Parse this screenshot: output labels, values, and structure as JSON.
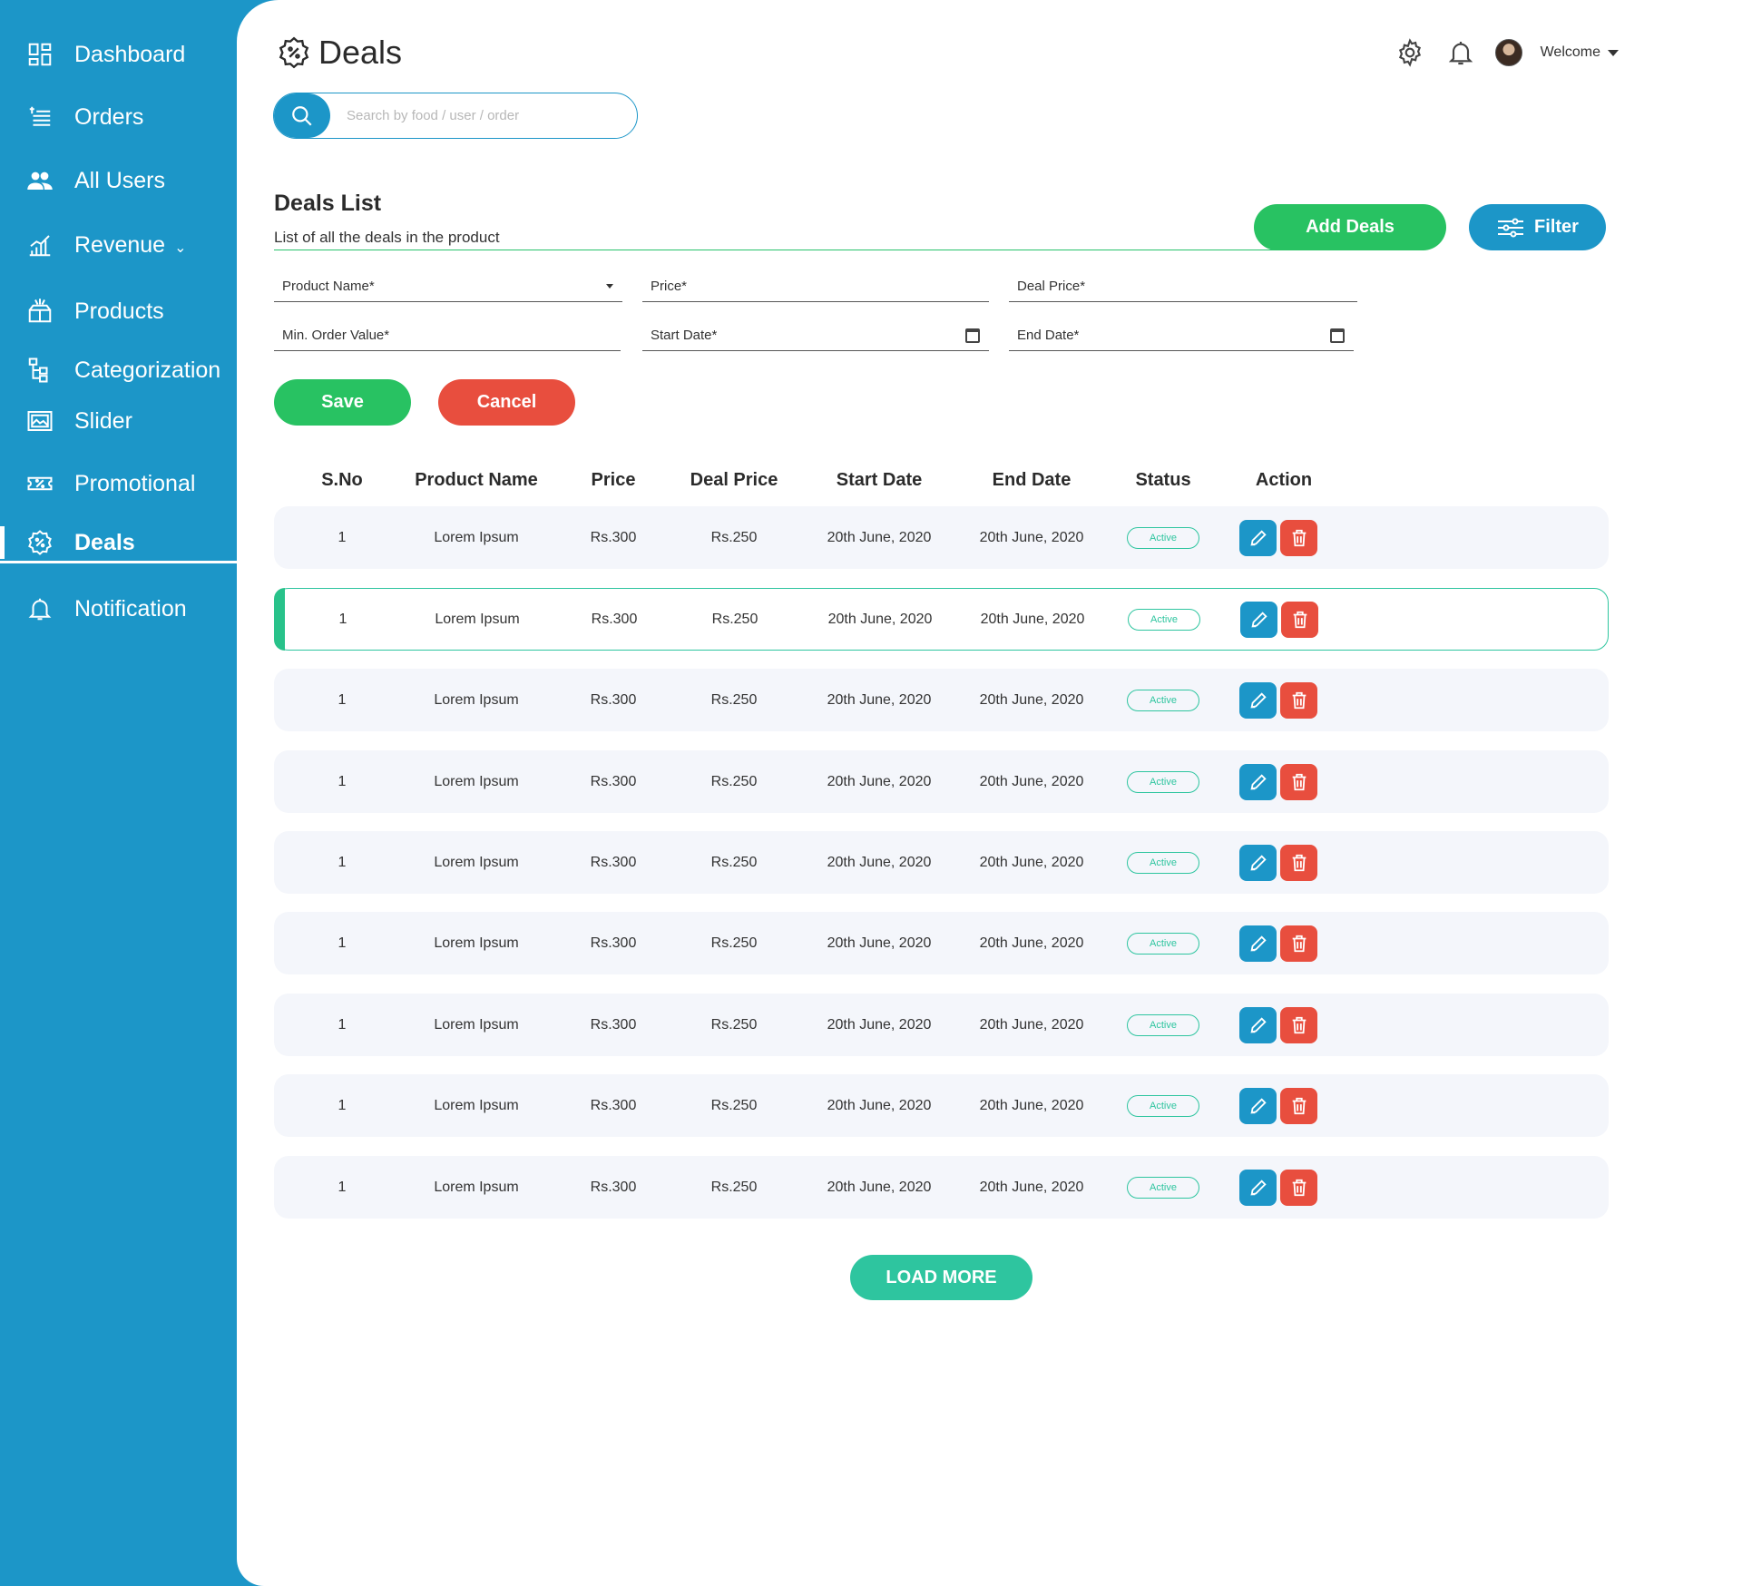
{
  "sidebar": {
    "items": [
      {
        "label": "Dashboard",
        "icon": "dashboard-icon"
      },
      {
        "label": "Orders",
        "icon": "orders-icon"
      },
      {
        "label": "All Users",
        "icon": "users-icon"
      },
      {
        "label": "Revenue",
        "icon": "revenue-icon"
      },
      {
        "label": "Products",
        "icon": "products-icon"
      },
      {
        "label": "Categorization",
        "icon": "categorization-icon"
      },
      {
        "label": "Slider",
        "icon": "slider-icon"
      },
      {
        "label": "Promotional",
        "icon": "promotional-icon"
      },
      {
        "label": "Deals",
        "icon": "deals-icon",
        "active": true
      },
      {
        "label": "Notification",
        "icon": "bell-icon"
      }
    ]
  },
  "header": {
    "title": "Deals",
    "welcome": "Welcome"
  },
  "search": {
    "placeholder": "Search by food / user / order"
  },
  "deals_list": {
    "title": "Deals List",
    "subtitle": "List of all the deals in the product",
    "add_label": "Add Deals",
    "filter_label": "Filter"
  },
  "form": {
    "product_name": "Product Name*",
    "price": "Price*",
    "deal_price": "Deal Price*",
    "min_order_value": "Min. Order Value*",
    "start_date": "Start Date*",
    "end_date": "End Date*",
    "save_label": "Save",
    "cancel_label": "Cancel"
  },
  "table": {
    "columns": [
      "S.No",
      "Product Name",
      "Price",
      "Deal Price",
      "Start Date",
      "End Date",
      "Status",
      "Action"
    ],
    "rows": [
      {
        "sno": "1",
        "product": "Lorem Ipsum",
        "price": "Rs.300",
        "deal_price": "Rs.250",
        "start": "20th June, 2020",
        "end": "20th June, 2020",
        "status": "Active"
      },
      {
        "sno": "1",
        "product": "Lorem Ipsum",
        "price": "Rs.300",
        "deal_price": "Rs.250",
        "start": "20th June, 2020",
        "end": "20th June, 2020",
        "status": "Active",
        "selected": true
      },
      {
        "sno": "1",
        "product": "Lorem Ipsum",
        "price": "Rs.300",
        "deal_price": "Rs.250",
        "start": "20th June, 2020",
        "end": "20th June, 2020",
        "status": "Active"
      },
      {
        "sno": "1",
        "product": "Lorem Ipsum",
        "price": "Rs.300",
        "deal_price": "Rs.250",
        "start": "20th June, 2020",
        "end": "20th June, 2020",
        "status": "Active"
      },
      {
        "sno": "1",
        "product": "Lorem Ipsum",
        "price": "Rs.300",
        "deal_price": "Rs.250",
        "start": "20th June, 2020",
        "end": "20th June, 2020",
        "status": "Active"
      },
      {
        "sno": "1",
        "product": "Lorem Ipsum",
        "price": "Rs.300",
        "deal_price": "Rs.250",
        "start": "20th June, 2020",
        "end": "20th June, 2020",
        "status": "Active"
      },
      {
        "sno": "1",
        "product": "Lorem Ipsum",
        "price": "Rs.300",
        "deal_price": "Rs.250",
        "start": "20th June, 2020",
        "end": "20th June, 2020",
        "status": "Active"
      },
      {
        "sno": "1",
        "product": "Lorem Ipsum",
        "price": "Rs.300",
        "deal_price": "Rs.250",
        "start": "20th June, 2020",
        "end": "20th June, 2020",
        "status": "Active"
      },
      {
        "sno": "1",
        "product": "Lorem Ipsum",
        "price": "Rs.300",
        "deal_price": "Rs.250",
        "start": "20th June, 2020",
        "end": "20th June, 2020",
        "status": "Active"
      }
    ]
  },
  "load_more_label": "LOAD MORE",
  "colors": {
    "sidebar": "#1c96c8",
    "primary_green": "#28c262",
    "danger": "#e84e3e",
    "teal": "#2ec59f"
  }
}
